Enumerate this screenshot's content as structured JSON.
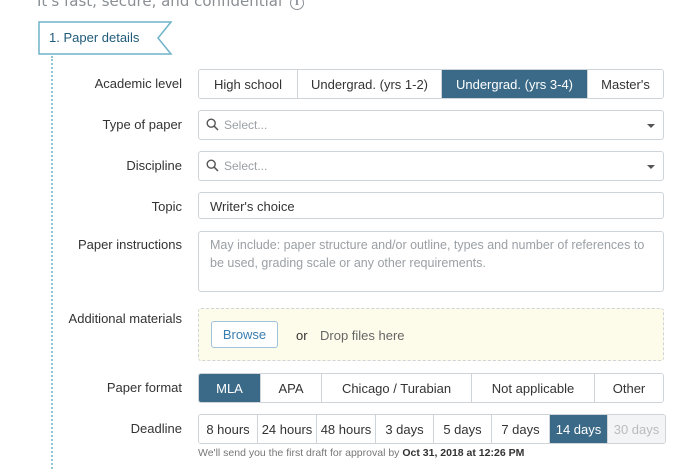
{
  "header": {
    "tagline": "It's fast, secure, and confidential",
    "info_glyph": "i"
  },
  "step": {
    "label": "1.  Paper details"
  },
  "academic_level": {
    "label": "Academic level",
    "options": [
      "High school",
      "Undergrad. (yrs 1-2)",
      "Undergrad. (yrs 3-4)",
      "Master's"
    ],
    "selected": "Undergrad. (yrs 3-4)"
  },
  "type_of_paper": {
    "label": "Type of paper",
    "placeholder": "Select..."
  },
  "discipline": {
    "label": "Discipline",
    "placeholder": "Select..."
  },
  "topic": {
    "label": "Topic",
    "value": "Writer's choice"
  },
  "instructions": {
    "label": "Paper instructions",
    "placeholder": "May include: paper structure and/or outline, types and number of references to be used, grading scale or any other requirements."
  },
  "materials": {
    "label": "Additional materials",
    "browse": "Browse",
    "or": "or",
    "drop": "Drop files here"
  },
  "paper_format": {
    "label": "Paper format",
    "options": [
      "MLA",
      "APA",
      "Chicago / Turabian",
      "Not applicable",
      "Other"
    ],
    "selected": "MLA"
  },
  "deadline": {
    "label": "Deadline",
    "options": [
      "8 hours",
      "24 hours",
      "48 hours",
      "3 days",
      "5 days",
      "7 days",
      "14 days",
      "30 days"
    ],
    "selected": "14 days",
    "disabled": [
      "30 days"
    ],
    "note_prefix": "We'll send you the first draft for approval by",
    "note_date": "Oct 31, 2018 at 12:26 PM"
  },
  "colors": {
    "selected": "#3b6a88",
    "accent": "#1f5a7a",
    "dropzone_bg": "#fdfbea",
    "border": "#cfd4d8"
  },
  "icons": [
    "info-icon",
    "search-icon",
    "caret-down-icon"
  ]
}
